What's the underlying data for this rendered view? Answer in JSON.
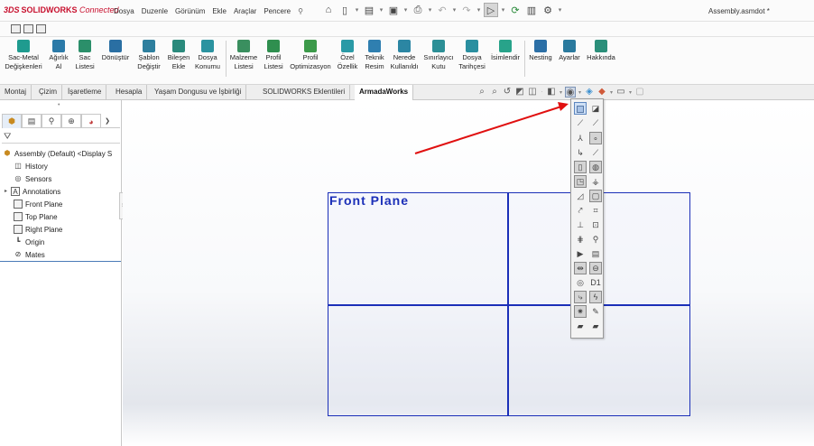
{
  "app": {
    "brand": "SOLIDWORKS",
    "brand_prefix": "3DS",
    "brand_suffix": "Connected",
    "document_title": "Assembly.asmdot *"
  },
  "menu": [
    "Dosya",
    "Duzenle",
    "Görünüm",
    "Ekle",
    "Araçlar",
    "Pencere"
  ],
  "ribbon": {
    "buttons": [
      {
        "label": "Sac-Metal\nDeğişkenleri",
        "color": "#1f9b8f"
      },
      {
        "label": "Ağırlık\nAl",
        "color": "#2b7aa8"
      },
      {
        "label": "Sac\nListesi",
        "color": "#2b8f6a"
      },
      {
        "label": "Dönüştür",
        "color": "#2a6fa3"
      },
      {
        "label": "Şablon\nDeğiştir",
        "color": "#2e7f9e"
      },
      {
        "label": "Bileşen\nEkle",
        "color": "#2a8a7c"
      },
      {
        "label": "Dosya\nKonumu",
        "color": "#2b93a0"
      },
      {
        "label": "Malzeme\nListesi",
        "color": "#3a8f5f"
      },
      {
        "label": "Profil\nListesi",
        "color": "#2f8f4f"
      },
      {
        "label": "Profil\nOptimizasyon",
        "color": "#3c9a4a"
      },
      {
        "label": "Özel\nÖzellik",
        "color": "#2a9aa6"
      },
      {
        "label": "Teknik\nResim",
        "color": "#2f7fb0"
      },
      {
        "label": "Nerede\nKullanıldı",
        "color": "#2b86a3"
      },
      {
        "label": "Sınırlayıcı\nKutu",
        "color": "#2c8f96"
      },
      {
        "label": "Dosya\nTarihçesi",
        "color": "#2a8fa0"
      },
      {
        "label": "İsimlendir",
        "color": "#28a38a"
      },
      {
        "label": "Nesting",
        "color": "#2b6fa6"
      },
      {
        "label": "Ayarlar",
        "color": "#2a7a9e"
      },
      {
        "label": "Hakkında",
        "color": "#2b8f7a"
      }
    ]
  },
  "tabs": [
    "Montaj",
    "Çizim",
    "İşaretleme",
    "Hesapla",
    "Yaşam Dongusu ve İşbirliği",
    "SOLIDWORKS Eklentileri",
    "ArmadaWorks"
  ],
  "active_tab": "ArmadaWorks",
  "tree": {
    "root": "Assembly (Default) <Display S",
    "items": [
      "History",
      "Sensors",
      "Annotations",
      "Front Plane",
      "Top Plane",
      "Right Plane",
      "Origin",
      "Mates"
    ]
  },
  "viewport": {
    "plane_label": "Front Plane",
    "plane_color": "#1b2fb8"
  },
  "flyout": {
    "text_icon": "D1"
  }
}
